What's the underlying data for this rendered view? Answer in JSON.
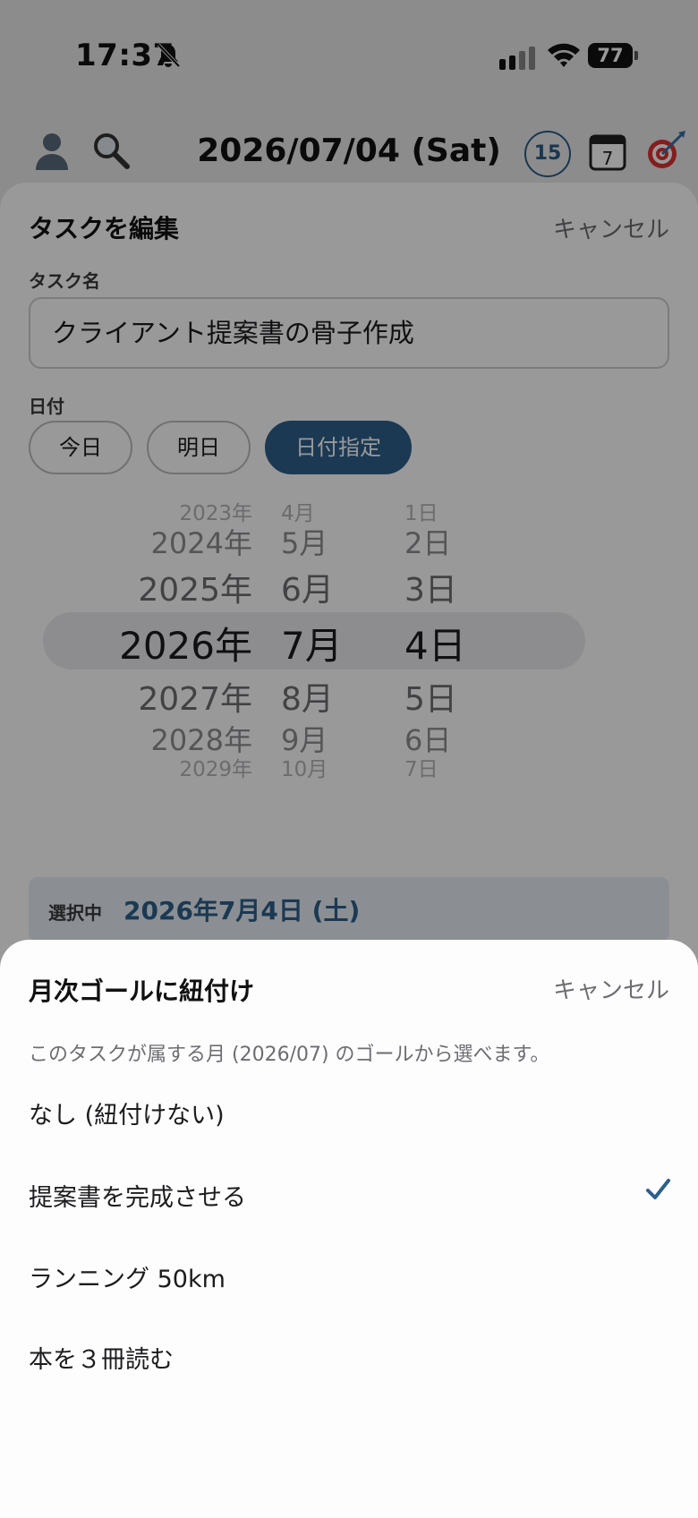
{
  "status_bar": {
    "time": "17:37",
    "battery": "77"
  },
  "header": {
    "date": "2026/07/04 (Sat)",
    "count_badge": "15",
    "calendar_day": "7"
  },
  "edit_sheet": {
    "title": "タスクを編集",
    "cancel_label": "キャンセル",
    "task_name_label": "タスク名",
    "task_name_value": "クライアント提案書の骨子作成",
    "date_label": "日付",
    "date_options": [
      "今日",
      "明日",
      "日付指定"
    ],
    "date_option_selected": "日付指定",
    "picker": {
      "rows": [
        {
          "year": "2023年",
          "month": "4月",
          "day": "1日"
        },
        {
          "year": "2024年",
          "month": "5月",
          "day": "2日"
        },
        {
          "year": "2025年",
          "month": "6月",
          "day": "3日"
        },
        {
          "year": "2026年",
          "month": "7月",
          "day": "4日"
        },
        {
          "year": "2027年",
          "month": "8月",
          "day": "5日"
        },
        {
          "year": "2028年",
          "month": "9月",
          "day": "6日"
        },
        {
          "year": "2029年",
          "month": "10月",
          "day": "7日"
        }
      ]
    },
    "selected_label": "選択中",
    "selected_value": "2026年7月4日 (土)"
  },
  "goal_sheet": {
    "title": "月次ゴールに紐付け",
    "cancel_label": "キャンセル",
    "description": "このタスクが属する月 (2026/07) のゴールから選べます。",
    "options": [
      {
        "label": "なし (紐付けない)",
        "checked": false
      },
      {
        "label": "提案書を完成させる",
        "checked": true
      },
      {
        "label": "ランニング 50km",
        "checked": false
      },
      {
        "label": "本を３冊読む",
        "checked": false
      }
    ]
  },
  "colors": {
    "accent": "#2e5f8a",
    "overlay": "rgba(0,0,0,0.40)"
  }
}
